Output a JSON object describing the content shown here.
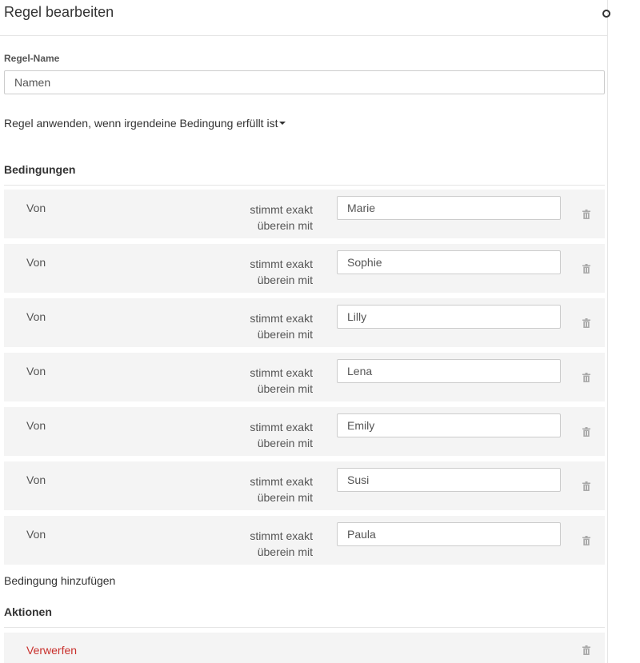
{
  "header": {
    "title": "Regel bearbeiten"
  },
  "rule_name": {
    "label": "Regel-Name",
    "value": "Namen"
  },
  "match_mode": {
    "label": "Regel anwenden, wenn irgendeine Bedingung erfüllt ist"
  },
  "conditions": {
    "title": "Bedingungen",
    "items": [
      {
        "field": "Von",
        "operator_line1": "stimmt exakt",
        "operator_line2": "überein mit",
        "value": "Marie"
      },
      {
        "field": "Von",
        "operator_line1": "stimmt exakt",
        "operator_line2": "überein mit",
        "value": "Sophie"
      },
      {
        "field": "Von",
        "operator_line1": "stimmt exakt",
        "operator_line2": "überein mit",
        "value": "Lilly"
      },
      {
        "field": "Von",
        "operator_line1": "stimmt exakt",
        "operator_line2": "überein mit",
        "value": "Lena"
      },
      {
        "field": "Von",
        "operator_line1": "stimmt exakt",
        "operator_line2": "überein mit",
        "value": "Emily"
      },
      {
        "field": "Von",
        "operator_line1": "stimmt exakt",
        "operator_line2": "überein mit",
        "value": "Susi"
      },
      {
        "field": "Von",
        "operator_line1": "stimmt exakt",
        "operator_line2": "überein mit",
        "value": "Paula"
      }
    ],
    "add_label": "Bedingung hinzufügen"
  },
  "actions": {
    "title": "Aktionen",
    "items": [
      {
        "label": "Verwerfen"
      }
    ]
  },
  "icons": {
    "delete": "trash-icon",
    "close": "close-icon",
    "dropdown": "caret-down-icon"
  },
  "colors": {
    "row_background": "#f4f4f4",
    "danger_text": "#c9302c",
    "border": "#cccccc"
  }
}
